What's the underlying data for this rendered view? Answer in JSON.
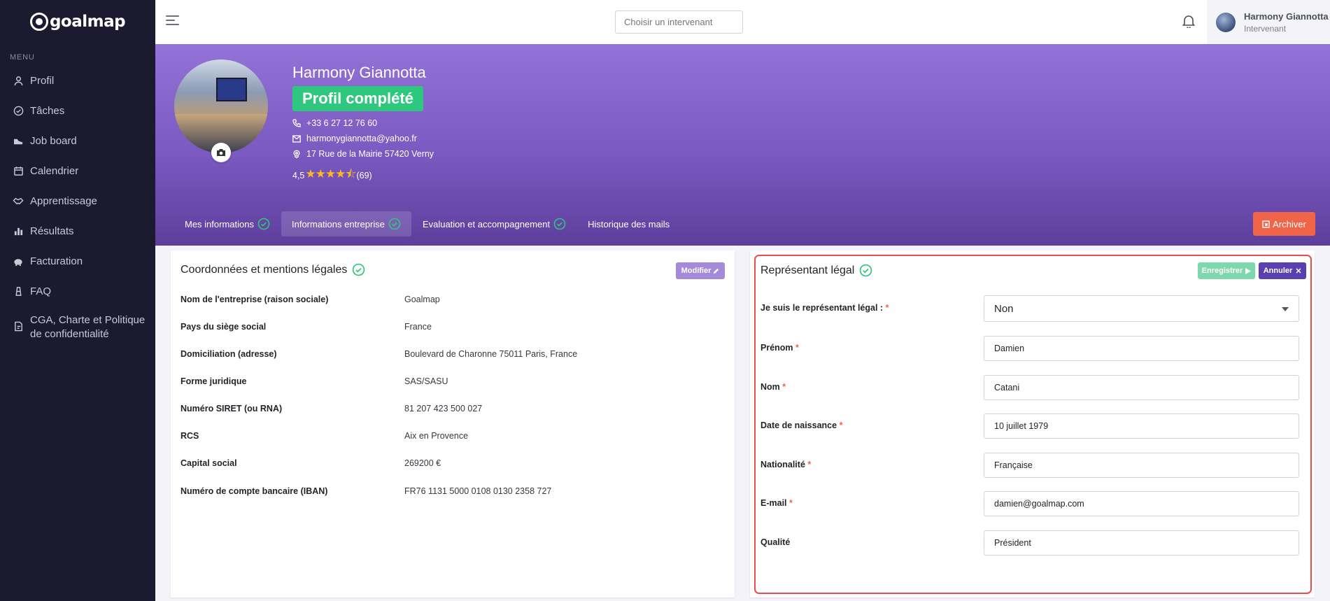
{
  "app": {
    "logo_text": "goalmap"
  },
  "sidebar": {
    "menu_title": "MENU",
    "items": [
      {
        "label": "Profil",
        "icon": "user-icon"
      },
      {
        "label": "Tâches",
        "icon": "check-circle-icon"
      },
      {
        "label": "Job board",
        "icon": "shoe-icon"
      },
      {
        "label": "Calendrier",
        "icon": "calendar-icon"
      },
      {
        "label": "Apprentissage",
        "icon": "handshake-icon"
      },
      {
        "label": "Résultats",
        "icon": "bar-chart-icon"
      },
      {
        "label": "Facturation",
        "icon": "piggy-bank-icon"
      },
      {
        "label": "FAQ",
        "icon": "lighthouse-icon"
      },
      {
        "label": "CGA, Charte et Politique de confidentialité",
        "icon": "document-edit-icon"
      }
    ]
  },
  "topbar": {
    "search_placeholder": "Choisir un intervenant",
    "user_name": "Harmony Giannotta",
    "user_role": "Intervenant"
  },
  "profile": {
    "name": "Harmony Giannotta",
    "status_badge": "Profil complété",
    "phone": "+33 6 27 12 76 60",
    "email": "harmonygiannotta@yahoo.fr",
    "address": "17 Rue de la Mairie 57420 Verny",
    "rating": "4,5",
    "stars": "★★★★⯪",
    "rating_count": "(69)"
  },
  "tabs": [
    {
      "label": "Mes informations",
      "checked": true
    },
    {
      "label": "Informations entreprise",
      "checked": true,
      "active": true
    },
    {
      "label": "Evaluation et accompagnement",
      "checked": true
    },
    {
      "label": "Historique des mails",
      "checked": false
    }
  ],
  "archive_label": "Archiver",
  "company_card": {
    "title": "Coordonnées et mentions légales",
    "modify_label": "Modifier",
    "rows": [
      {
        "label": "Nom de l'entreprise (raison sociale)",
        "value": "Goalmap"
      },
      {
        "label": "Pays du siège social",
        "value": "France"
      },
      {
        "label": "Domiciliation (adresse)",
        "value": "Boulevard de Charonne 75011 Paris, France"
      },
      {
        "label": "Forme juridique",
        "value": "SAS/SASU"
      },
      {
        "label": "Numéro SIRET (ou RNA)",
        "value": "81 207 423 500 027"
      },
      {
        "label": "RCS",
        "value": "Aix en Provence"
      },
      {
        "label": "Capital social",
        "value": "269200 €"
      },
      {
        "label": "Numéro de compte bancaire (IBAN)",
        "value": "FR76 1131 5000 0108 0130 2358 727"
      }
    ]
  },
  "legal_rep_card": {
    "title": "Représentant légal",
    "save_label": "Enregistrer",
    "cancel_label": "Annuler",
    "is_legal_rep_label": "Je suis le représentant légal :",
    "is_legal_rep_value": "Non",
    "fields": [
      {
        "label": "Prénom",
        "value": "Damien",
        "required": true
      },
      {
        "label": "Nom",
        "value": "Catani",
        "required": true
      },
      {
        "label": "Date de naissance",
        "value": "10 juillet 1979",
        "required": true
      },
      {
        "label": "Nationalité",
        "value": "Française",
        "required": true
      },
      {
        "label": "E-mail",
        "value": "damien@goalmap.com",
        "required": true
      },
      {
        "label": "Qualité",
        "value": "Président",
        "required": false
      }
    ]
  },
  "colors": {
    "sidebar_bg": "#1b1a2e",
    "banner_purple": "#7a59c0",
    "success_green": "#2ec77e",
    "archive_red": "#f06548",
    "cancel_purple": "#5a3fb0",
    "highlight_red": "#ef4b4b"
  }
}
